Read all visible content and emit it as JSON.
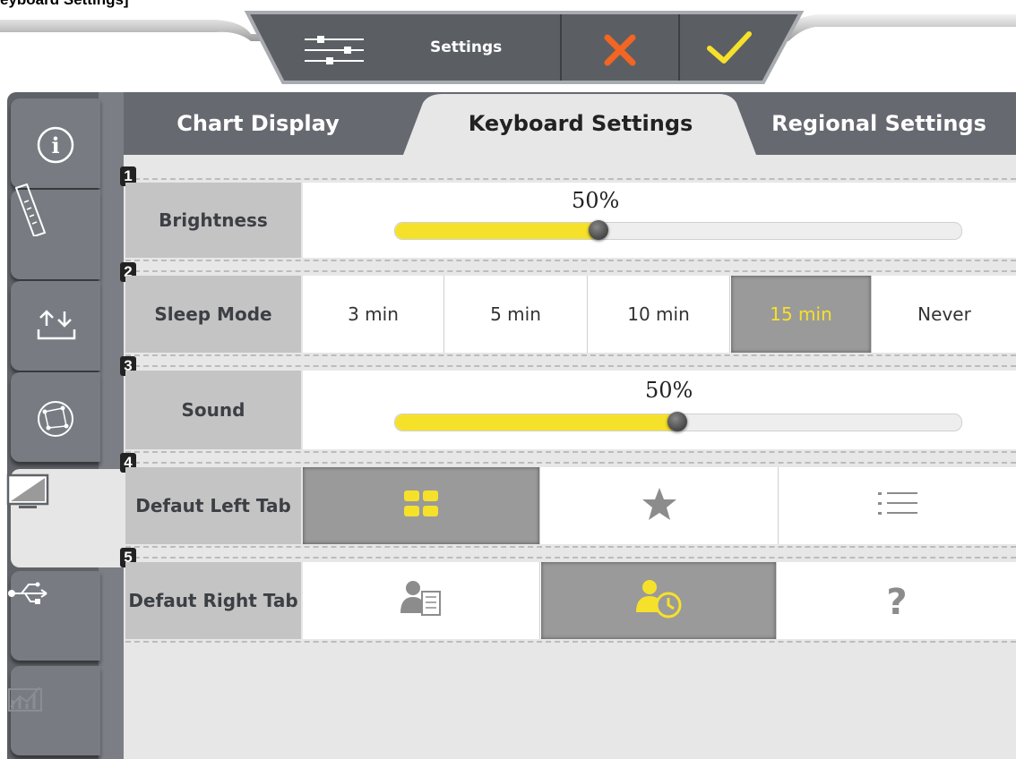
{
  "caption": "eyboard Settings]",
  "toolbar": {
    "settings_label": "Settings",
    "settings_icon": "sliders-icon",
    "cancel_icon": "close-icon",
    "confirm_icon": "check-icon",
    "cancel_color": "#f26522",
    "confirm_color": "#f6e12a"
  },
  "sidebar": {
    "items": [
      {
        "icon": "info-icon"
      },
      {
        "icon": "ruler-icon"
      },
      {
        "icon": "upload-download-icon"
      },
      {
        "icon": "globe-network-icon"
      },
      {
        "icon": "monitor-icon",
        "active": true
      },
      {
        "icon": "usb-icon"
      },
      {
        "icon": "chart-icon",
        "disabled": true
      }
    ]
  },
  "tabs": [
    {
      "label": "Chart Display"
    },
    {
      "label": "Keyboard Settings",
      "active": true
    },
    {
      "label": "Regional Settings"
    }
  ],
  "rows": {
    "brightness": {
      "num": "1",
      "label": "Brightness",
      "value_text": "50%",
      "value": 0.36
    },
    "sleep": {
      "num": "2",
      "label": "Sleep Mode",
      "options": [
        "3 min",
        "5 min",
        "10 min",
        "15 min",
        "Never"
      ],
      "selected": "15 min"
    },
    "sound": {
      "num": "3",
      "label": "Sound",
      "value_text": "50%",
      "value": 0.5
    },
    "left_tab": {
      "num": "4",
      "label": "Defaut Left Tab",
      "options": [
        "grid-icon",
        "star-icon",
        "list-icon"
      ],
      "selected": "grid-icon"
    },
    "right_tab": {
      "num": "5",
      "label": "Defaut Right Tab",
      "options": [
        "user-document-icon",
        "user-clock-icon",
        "question-icon"
      ],
      "selected": "user-clock-icon"
    }
  },
  "accent": "#f6e12a"
}
